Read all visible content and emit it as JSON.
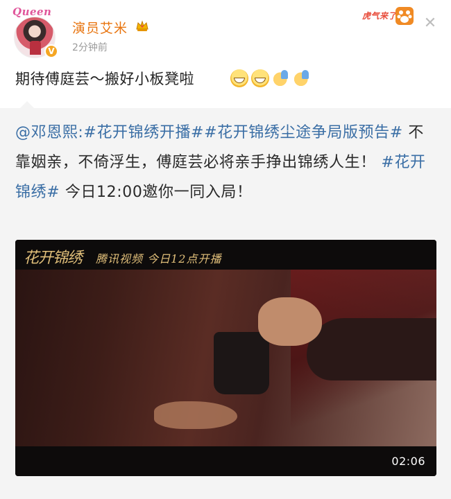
{
  "author": {
    "avatar_tag": "Queen",
    "name": "演员艾米",
    "verified_icon": "verified-badge-icon",
    "time": "2分钟前"
  },
  "header_extras": {
    "sticker_text": "虎气来了",
    "sticker_icon": "paw-icon",
    "close_icon": "close-icon"
  },
  "post": {
    "text": "期待傅庭芸～搬好小板凳啦",
    "emojis": [
      "grin",
      "grin",
      "wave",
      "wave"
    ]
  },
  "repost": {
    "mention": "@邓恩熙",
    "colon": ":",
    "tag1": "#花开锦绣开播#",
    "tag2": "#花开锦绣尘途争局版预告#",
    "text1": " 不靠姻亲，不倚浮生，傅庭芸必将亲手挣出锦绣人生！",
    "tag3": "#花开锦绣#",
    "text2": " 今日12:00邀你一同入局！"
  },
  "video": {
    "logo": "花开锦绣",
    "caption": "腾讯视频  今日12点开播",
    "duration": "02:06"
  },
  "colors": {
    "username": "#e8740e",
    "link": "#3a6ea5",
    "repost_bg": "#f4f4f4"
  }
}
